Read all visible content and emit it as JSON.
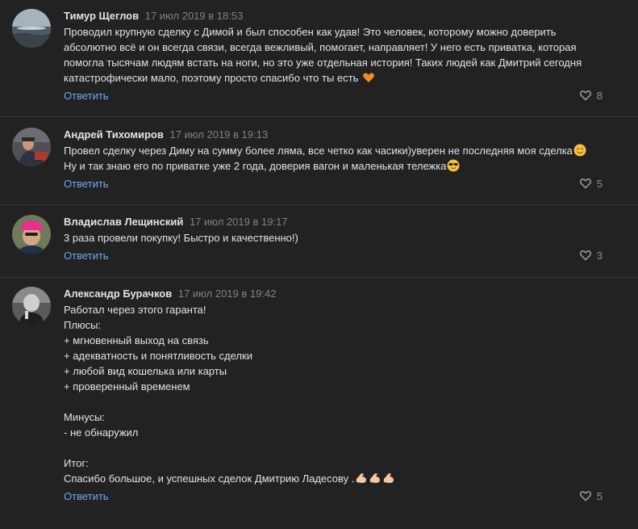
{
  "comments": [
    {
      "author": "Тимур Щеглов",
      "date": "17 июл 2019 в 18:53",
      "lines": [
        "Проводил крупную сделку с Димой и был способен как удав! Это человек, которому можно доверить",
        "абсолютно всё и он всегда связи, всегда вежливый, помогает, направляет! У него есть приватка, которая",
        "помогла тысячам людям встать на ноги, но это уже отдельная история! Таких людей как Дмитрий сегодня",
        "катастрофически мало, поэтому просто спасибо что ты есть"
      ],
      "emoji": "orange-heart",
      "reply": "Ответить",
      "likes": "8"
    },
    {
      "author": "Андрей Тихомиров",
      "date": "17 июл 2019 в 19:13",
      "lines": [
        "Провел сделку через Диму на сумму более ляма, все четко как часики)уверен не последняя моя сделка",
        "Ну и так знаю его по приватке уже 2 года, доверия вагон и маленькая тележка"
      ],
      "reply": "Ответить",
      "likes": "5"
    },
    {
      "author": "Владислав Лещинский",
      "date": "17 июл 2019 в 19:17",
      "lines": [
        "3 раза провели покупку! Быстро и качественно!)"
      ],
      "reply": "Ответить",
      "likes": "3"
    },
    {
      "author": "Александр Бурачков",
      "date": "17 июл 2019 в 19:42",
      "lines": [
        "Работал через этого гаранта!",
        "Плюсы:",
        "+ мгновенный выход на связь",
        "+ адекватность и понятливость сделки",
        "+ любой вид кошелька или карты",
        "+ проверенный временем",
        "",
        "Минусы:",
        "- не обнаружил",
        "",
        "Итог:",
        "Спасибо большое, и успешных сделок Дмитрию Ладесову ."
      ],
      "reply": "Ответить",
      "likes": "5"
    }
  ],
  "colors": {
    "background": "#222222",
    "text": "#e1e3e6",
    "muted": "#828282",
    "link": "#71aaeb",
    "separator": "#363738"
  }
}
